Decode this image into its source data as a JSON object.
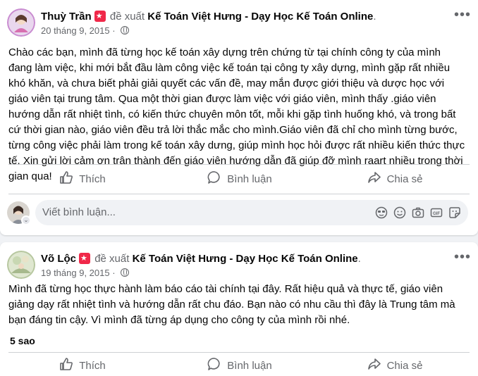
{
  "posts": [
    {
      "author": "Thuỳ Trần",
      "recommends": "đề xuất",
      "page": "Kế Toán Việt Hưng - Dạy Học Kế Toán Online",
      "date": "20 tháng 9, 2015",
      "text": "Chào các bạn, mình đã từng học kế toán xây dựng trên chứng từ tại chính công ty của mình đang làm việc, khi mới bắt đầu làm công việc kế toán tại công ty xây dựng, mình gặp rất nhiều khó khăn, và chưa biết phải giải quyết các vấn đề, may mắn được giới thiệu và dược học với giáo viên tại trung tâm. Qua một thời gian được làm việc với giáo viên, mình thấy .giáo viên hướng dẫn  rất nhiệt tình, có kiến thức chuyên môn tốt, mỗi khi gặp tình huống khó, và trong bất cứ thời gian nào, giáo viên đều trả lời thắc mắc cho mình.Giáo viên đã chỉ cho mình từng bước, từng công việc phải làm trong kế toán xây dưng, giúp mình học hỏi được rất nhiều kiến thức thực tế. Xin gửi lời cảm ơn trân thành đến giáo viên hướng dẫn đã giúp đỡ mình raart nhiều trong thời gian qua!",
      "actions": {
        "like": "Thích",
        "comment": "Bình luận",
        "share": "Chia sẻ"
      },
      "comment_placeholder": "Viết bình luận..."
    },
    {
      "author": "Võ Lộc",
      "recommends": "đề xuất",
      "page": "Kế Toán Việt Hưng - Dạy Học Kế Toán Online",
      "date": "19 tháng 9, 2015",
      "text": "Mình đã từng học thực hành làm báo cáo tài chính tại đây. Rất hiệu quả và thực tế, giáo viên giảng dạy rất nhiệt tình và hướng dẫn rất chu đáo. Bạn nào có nhu cầu thì đây là Trung tâm mà bạn đáng tin cậy. Vì mình đã từng áp dụng cho công ty của mình rồi nhé.",
      "rating": "5 sao",
      "actions": {
        "like": "Thích",
        "comment": "Bình luận",
        "share": "Chia sẻ"
      }
    }
  ],
  "colors": {
    "text": "#050505",
    "muted": "#65676b",
    "badge": "#f02849",
    "background": "#f0f2f5"
  }
}
